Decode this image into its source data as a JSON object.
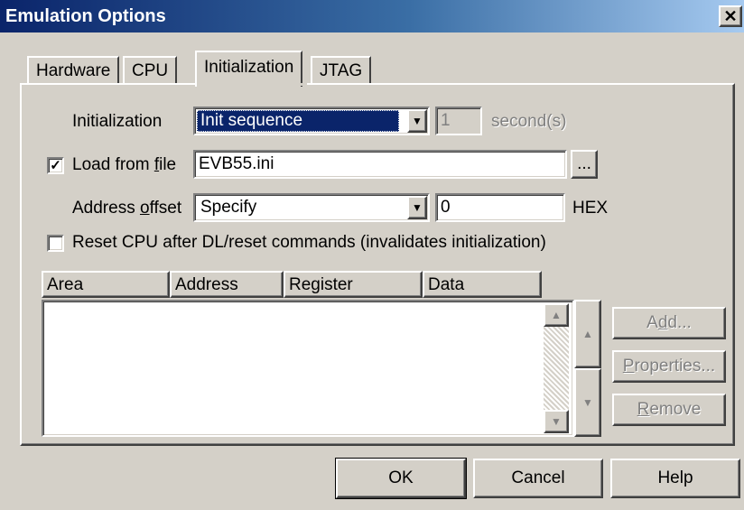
{
  "window": {
    "title": "Emulation Options",
    "close_glyph": "✕"
  },
  "tabs": [
    {
      "label": "Hardware"
    },
    {
      "label": "CPU"
    },
    {
      "label": "Initialization",
      "active": true
    },
    {
      "label": "JTAG"
    }
  ],
  "initialization": {
    "label": "Initialization",
    "mode_value": "Init sequence",
    "delay_value": "1",
    "delay_unit": "second(s)"
  },
  "load_from_file": {
    "checked": true,
    "check_mark": "✓",
    "label_prefix": "Load from ",
    "label_accel": "f",
    "label_suffix": "ile",
    "value": "EVB55.ini",
    "browse_label": "..."
  },
  "address_offset": {
    "label_prefix": "Address ",
    "label_accel": "o",
    "label_suffix": "ffset",
    "mode_value": "Specify",
    "value": "0",
    "unit": "HEX"
  },
  "reset_cpu": {
    "checked": false,
    "label": "Reset CPU after DL/reset commands (invalidates initialization)"
  },
  "table": {
    "columns": [
      "Area",
      "Address",
      "Register",
      "Data"
    ],
    "rows": []
  },
  "side_buttons": {
    "add": {
      "prefix": "A",
      "accel": "d",
      "suffix": "d..."
    },
    "properties": {
      "prefix": "",
      "accel": "P",
      "suffix": "roperties..."
    },
    "remove": {
      "prefix": "",
      "accel": "R",
      "suffix": "emove"
    }
  },
  "footer": {
    "ok": "OK",
    "cancel": "Cancel",
    "help": "Help"
  },
  "icons": {
    "dropdown": "dropdown-arrow-icon",
    "scroll_up": "scroll-up-arrow-icon",
    "scroll_down": "scroll-down-arrow-icon",
    "move_up": "move-up-arrow-icon",
    "move_down": "move-down-arrow-icon"
  },
  "colors": {
    "face": "#d4d0c8",
    "selection": "#0a246a",
    "title_gradient_start": "#0a246a",
    "title_gradient_end": "#a6caf0",
    "disabled_text": "#808080"
  }
}
